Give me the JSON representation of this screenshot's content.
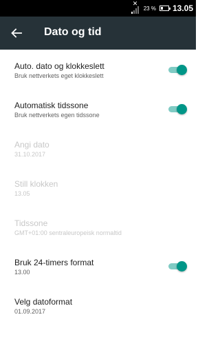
{
  "status_bar": {
    "signal_icon": "no-signal-icon",
    "battery_percent": "23 %",
    "battery_icon": "battery-icon",
    "time": "13.05"
  },
  "toolbar": {
    "back_icon": "arrow-back-icon",
    "title": "Dato og tid"
  },
  "settings": [
    {
      "label": "Auto. dato og klokkeslett",
      "summary": "Bruk nettverkets eget klokkeslett",
      "toggle": true,
      "enabled": true
    },
    {
      "label": "Automatisk tidssone",
      "summary": "Bruk nettverkets egen tidssone",
      "toggle": true,
      "enabled": true
    },
    {
      "label": "Angi dato",
      "summary": "31.10.2017",
      "toggle": false,
      "enabled": false
    },
    {
      "label": "Still klokken",
      "summary": "13.05",
      "toggle": false,
      "enabled": false
    },
    {
      "label": "Tidssone",
      "summary": "GMT+01:00 sentraleuropeisk normaltid",
      "toggle": false,
      "enabled": false
    },
    {
      "label": "Bruk 24-timers format",
      "summary": "13.00",
      "toggle": true,
      "enabled": true
    },
    {
      "label": "Velg datoformat",
      "summary": "01.09.2017",
      "toggle": false,
      "enabled": true
    }
  ],
  "colors": {
    "toolbar": "#263238",
    "accent": "#009688",
    "accent_track": "#80cbc4",
    "disabled_text": "#c7c7c7"
  }
}
